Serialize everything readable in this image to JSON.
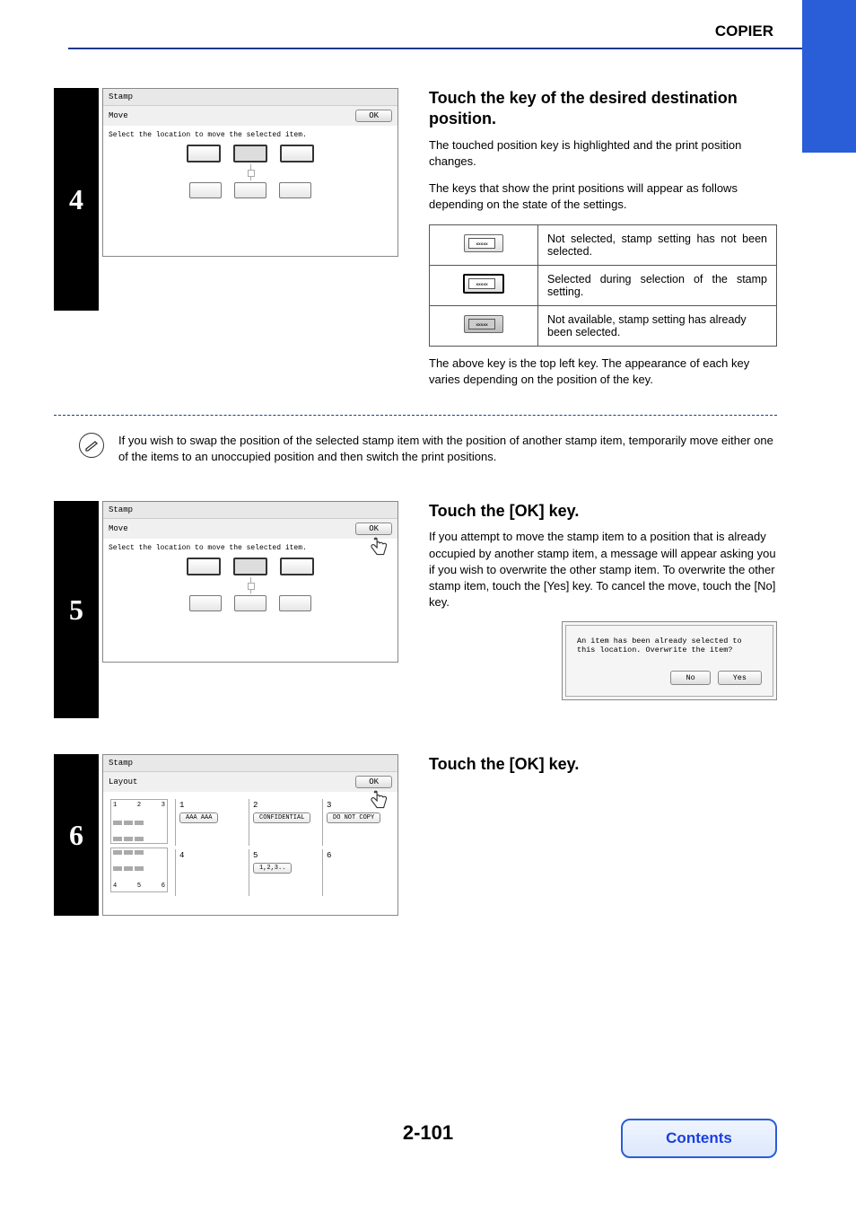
{
  "header": {
    "title": "COPIER"
  },
  "step4": {
    "num": "4",
    "screen": {
      "title": "Stamp",
      "subtitle": "Move",
      "ok_label": "OK",
      "instruction": "Select the location to move the selected item."
    },
    "heading": "Touch the key of the desired destination position.",
    "p1": "The touched position key is highlighted and the print position changes.",
    "p2": "The keys that show the print positions will appear as follows depending on the state of the settings.",
    "states": [
      {
        "desc": "Not selected, stamp setting has not been selected."
      },
      {
        "desc": "Selected during selection of the stamp setting."
      },
      {
        "desc": "Not available, stamp setting has already been selected."
      }
    ],
    "p3": "The above key is the top left key. The appearance of each key varies depending on the position of the key."
  },
  "note": {
    "text": "If you wish to swap the position of the selected stamp item with the position of another stamp item, temporarily move either one of the items to an unoccupied position and then switch the print positions."
  },
  "step5": {
    "num": "5",
    "screen": {
      "title": "Stamp",
      "subtitle": "Move",
      "ok_label": "OK",
      "instruction": "Select the location to move the selected item."
    },
    "heading": "Touch the [OK] key.",
    "p1": "If you attempt to move the stamp item to a position that is already occupied by another stamp item, a message will appear asking you if you wish to overwrite the other stamp item. To overwrite the other stamp item, touch the [Yes] key. To cancel the move, touch the [No] key.",
    "dialog": {
      "msg": "An item has been already selected to this location. Overwrite the item?",
      "no": "No",
      "yes": "Yes"
    }
  },
  "step6": {
    "num": "6",
    "screen": {
      "title": "Stamp",
      "subtitle": "Layout",
      "ok_label": "OK",
      "cells": {
        "c1": "1",
        "c2": "2",
        "c3": "3",
        "c4": "4",
        "c5": "5",
        "c6": "6",
        "chip1": "AAA AAA",
        "chip2": "CONFIDENTIAL",
        "chip3": "DO NOT COPY",
        "chip5": "1,2,3.."
      }
    },
    "heading": "Touch the [OK] key."
  },
  "footer": {
    "page_number": "2-101",
    "contents": "Contents"
  }
}
